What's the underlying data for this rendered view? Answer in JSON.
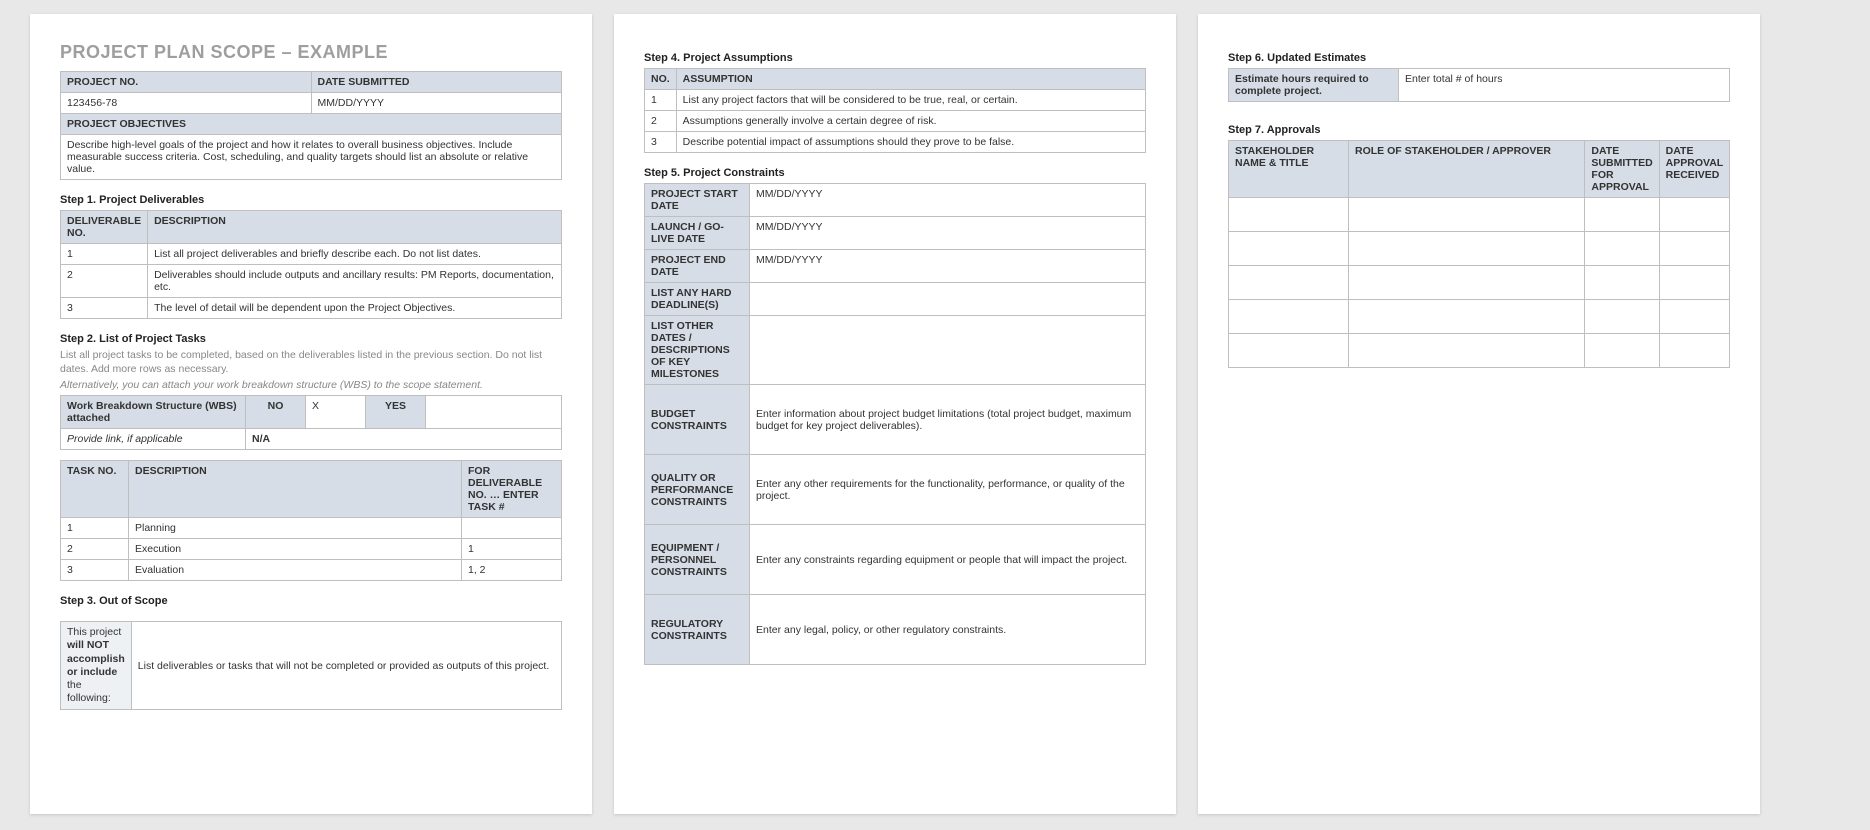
{
  "title": "PROJECT PLAN SCOPE – EXAMPLE",
  "project_info": {
    "project_no_header": "PROJECT NO.",
    "date_submitted_header": "DATE SUBMITTED",
    "project_no": "123456-78",
    "date_submitted": "MM/DD/YYYY",
    "objectives_header": "PROJECT OBJECTIVES",
    "objectives_text": "Describe high-level goals of the project and how it relates to overall business objectives.  Include measurable success criteria.  Cost, scheduling, and quality targets should list an absolute or relative value."
  },
  "step1": {
    "title": "Step 1. Project Deliverables",
    "h1": "DELIVERABLE NO.",
    "h2": "DESCRIPTION",
    "rows": [
      {
        "no": "1",
        "desc": "List all project deliverables and briefly describe each. Do not list dates."
      },
      {
        "no": "2",
        "desc": "Deliverables should include outputs and ancillary results: PM Reports, documentation, etc."
      },
      {
        "no": "3",
        "desc": "The level of detail will be dependent upon the Project Objectives."
      }
    ]
  },
  "step2": {
    "title": "Step 2. List of Project Tasks",
    "sub": "List all project tasks to be completed, based on the deliverables listed in the previous section. Do not list dates. Add more rows as necessary.",
    "sub_italic": "Alternatively, you can attach your work breakdown structure (WBS) to the scope statement.",
    "wbs_label": "Work Breakdown Structure (WBS) attached",
    "no_label": "NO",
    "yes_label": "YES",
    "no_val": "X",
    "yes_val": "",
    "link_label": "Provide link, if applicable",
    "link_val": "N/A",
    "h1": "TASK NO.",
    "h2": "DESCRIPTION",
    "h3": "FOR DELIVERABLE NO. … ENTER TASK #",
    "rows": [
      {
        "no": "1",
        "desc": "Planning",
        "for": ""
      },
      {
        "no": "2",
        "desc": "Execution",
        "for": "1"
      },
      {
        "no": "3",
        "desc": "Evaluation",
        "for": "1, 2"
      }
    ]
  },
  "step3": {
    "title": "Step 3. Out of Scope",
    "label_pre": "This project ",
    "label_bold": "will NOT accomplish or include ",
    "label_post": "the following:",
    "desc": "List deliverables or tasks that will not be completed or provided as outputs of this project."
  },
  "step4": {
    "title": "Step 4. Project Assumptions",
    "h1": "NO.",
    "h2": "ASSUMPTION",
    "rows": [
      {
        "no": "1",
        "desc": "List any project factors that will be considered to be true, real, or certain."
      },
      {
        "no": "2",
        "desc": "Assumptions generally involve a certain degree of risk."
      },
      {
        "no": "3",
        "desc": "Describe potential impact of assumptions should they prove to be false."
      }
    ]
  },
  "step5": {
    "title": "Step 5. Project Constraints",
    "r_start_label": "PROJECT START DATE",
    "r_start_val": "MM/DD/YYYY",
    "r_launch_label": "LAUNCH / GO-LIVE DATE",
    "r_launch_val": "MM/DD/YYYY",
    "r_end_label": "PROJECT END DATE",
    "r_end_val": "MM/DD/YYYY",
    "r_hard_label": "LIST ANY HARD DEADLINE(S)",
    "r_hard_val": "",
    "r_other_label": "LIST OTHER DATES / DESCRIPTIONS OF KEY MILESTONES",
    "r_other_val": "",
    "r_budget_label": "BUDGET CONSTRAINTS",
    "r_budget_val": "Enter information about project budget limitations (total project budget, maximum budget for key project deliverables).",
    "r_quality_label": "QUALITY OR PERFORMANCE CONSTRAINTS",
    "r_quality_val": "Enter any other requirements for the functionality, performance, or quality of the project.",
    "r_equip_label": "EQUIPMENT / PERSONNEL CONSTRAINTS",
    "r_equip_val": "Enter any constraints regarding equipment or people that will impact the project.",
    "r_reg_label": "REGULATORY CONSTRAINTS",
    "r_reg_val": "Enter any legal, policy, or other regulatory constraints."
  },
  "step6": {
    "title": "Step 6. Updated Estimates",
    "label": "Estimate hours required to complete project.",
    "value": "Enter total # of hours"
  },
  "step7": {
    "title": "Step 7. Approvals",
    "h1": "STAKEHOLDER NAME & TITLE",
    "h2": "ROLE OF STAKEHOLDER / APPROVER",
    "h3": "DATE SUBMITTED FOR APPROVAL",
    "h4": "DATE APPROVAL RECEIVED"
  }
}
